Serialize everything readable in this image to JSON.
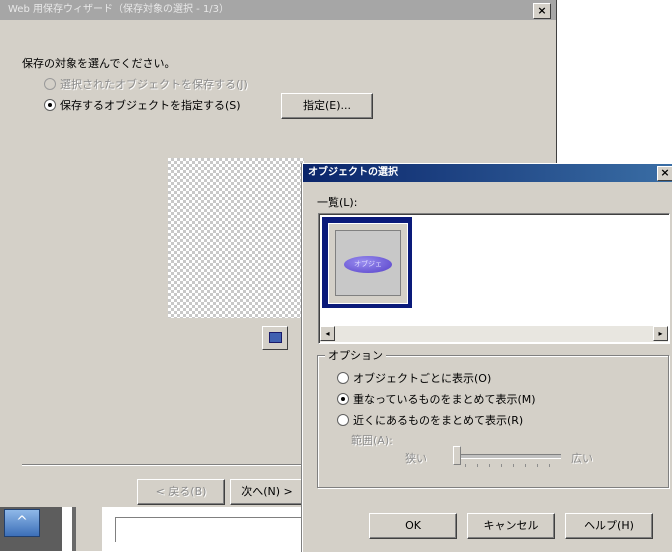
{
  "wizard": {
    "title": "Web 用保存ウィザード（保存対象の選択 - 1/3）",
    "prompt": "保存の対象を選んでください。",
    "radio_selected_object": "選択されたオブジェクトを保存する(J)",
    "radio_specify_object": "保存するオブジェクトを指定する(S)",
    "specify_button": "指定(E)...",
    "back_button": "< 戻る(B)",
    "next_button": "次へ(N) >",
    "close_glyph": "×"
  },
  "taskbar": {
    "icon_glyph": "^"
  },
  "dialog": {
    "title": "オブジェクトの選択",
    "close_glyph": "×",
    "list_label": "一覧(L):",
    "thumbnail_text": "オブジェ",
    "scroll_left_glyph": "◂",
    "scroll_right_glyph": "▸",
    "options_group": "オプション",
    "option_per_object": "オブジェクトごとに表示(O)",
    "option_overlapping": "重なっているものをまとめて表示(M)",
    "option_nearby": "近くにあるものをまとめて表示(R)",
    "range_label": "範囲(A):",
    "slider_min": "狭い",
    "slider_max": "広い",
    "ok_button": "OK",
    "cancel_button": "キャンセル",
    "help_button": "ヘルプ(H)"
  },
  "colors": {
    "dialog_titlebar": "#0a246a",
    "selection_border": "#0a1a7a",
    "oval_fill": "#5540c8"
  }
}
